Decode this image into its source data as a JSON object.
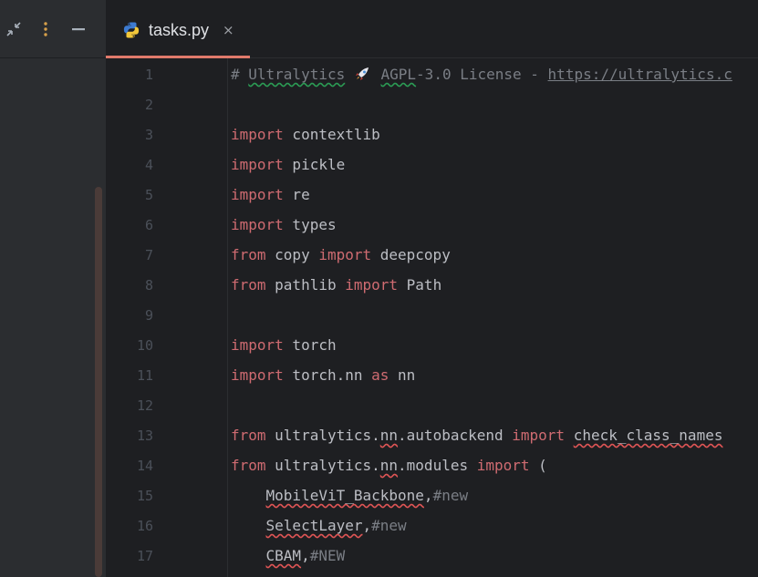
{
  "left_panel": {
    "icons": [
      "collapse-icon",
      "more-options-icon",
      "minimize-icon"
    ]
  },
  "editor": {
    "tab": {
      "filename": "tasks.py",
      "close_glyph": "×",
      "icon": "python-file-icon"
    },
    "line_numbers": [
      "1",
      "2",
      "3",
      "4",
      "5",
      "6",
      "7",
      "8",
      "9",
      "10",
      "11",
      "12",
      "13",
      "14",
      "15",
      "16",
      "17"
    ],
    "lines": {
      "l1": {
        "hash": "# ",
        "ultralytics": "Ultralytics",
        "agpl": "AGPL",
        "license": "-3.0 License - ",
        "url": "https://ultralytics.c"
      },
      "l3": {
        "kw": "import",
        "rest": " contextlib"
      },
      "l4": {
        "kw": "import",
        "rest": " pickle"
      },
      "l5": {
        "kw": "import",
        "rest": " re"
      },
      "l6": {
        "kw": "import",
        "rest": " types"
      },
      "l7": {
        "kw1": "from",
        "mod": " copy ",
        "kw2": "import",
        "rest": " deepcopy"
      },
      "l8": {
        "kw1": "from",
        "mod": " pathlib ",
        "kw2": "import",
        "rest": " Path"
      },
      "l10": {
        "kw": "import",
        "rest": " torch"
      },
      "l11": {
        "kw1": "import",
        "mod": " torch.nn ",
        "kw2": "as",
        "rest": " nn"
      },
      "l13": {
        "kw1": "from",
        "mod_a": " ultralytics.",
        "nn": "nn",
        "mod_b": ".autobackend ",
        "kw2": "import",
        "sp": " ",
        "rest": "check_class_names"
      },
      "l14": {
        "kw1": "from",
        "mod_a": " ultralytics.",
        "nn": "nn",
        "mod_b": ".modules ",
        "kw2": "import",
        "rest": " ("
      },
      "l15": {
        "indent": "    ",
        "name": "MobileViT_Backbone",
        "comma": ",",
        "comment": "#new"
      },
      "l16": {
        "indent": "    ",
        "name": "SelectLayer",
        "comma": ",",
        "comment": "#new"
      },
      "l17": {
        "indent": "    ",
        "name": "CBAM",
        "comma": ",",
        "comment": "#NEW"
      }
    }
  },
  "colors": {
    "keyword": "#cf6b71",
    "comment": "#7a7e85",
    "text": "#bcbec4",
    "tab_accent": "#e07a6b"
  }
}
